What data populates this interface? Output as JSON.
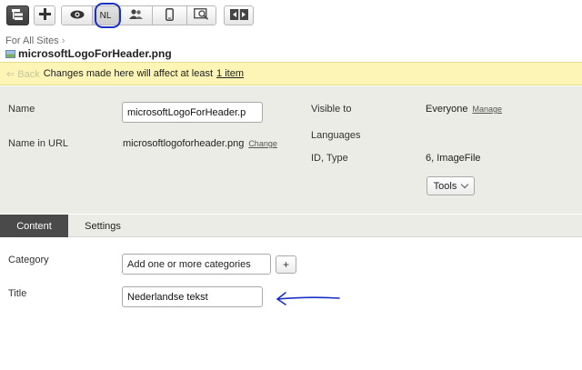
{
  "toolbar": {
    "buttons": [
      {
        "name": "tree-icon"
      },
      {
        "name": "add-icon",
        "glyph": "+"
      },
      {
        "name": "preview-eye-icon"
      },
      {
        "name": "language-button",
        "label": "NL"
      },
      {
        "name": "visitor-groups-icon"
      },
      {
        "name": "mobile-device-icon"
      },
      {
        "name": "zoom-preview-icon"
      },
      {
        "name": "compare-icon"
      }
    ],
    "highlight_color": "#1a2fc4"
  },
  "breadcrumb": {
    "label": "For All Sites",
    "separator": "›"
  },
  "page_title": "microsoftLogoForHeader.png",
  "notice": {
    "back_label": "⇐ Back",
    "text": "Changes made here will affect at least",
    "link": "1 item",
    "background": "#fcf5b5"
  },
  "properties": {
    "name_label": "Name",
    "name_value": "microsoftLogoForHeader.p",
    "url_label": "Name in URL",
    "url_value": "microsoftlogoforheader.png",
    "url_change": "Change",
    "visible_label": "Visible to",
    "visible_value": "Everyone",
    "visible_manage": "Manage",
    "languages_label": "Languages",
    "id_label": "ID, Type",
    "id_value": "6, ImageFile",
    "tools_label": "Tools"
  },
  "tabs": [
    {
      "label": "Content",
      "active": true
    },
    {
      "label": "Settings",
      "active": false
    }
  ],
  "content": {
    "category_label": "Category",
    "category_placeholder": "Add one or more categories",
    "category_add": "+",
    "title_label": "Title",
    "title_value": "Nederlandse tekst"
  },
  "annotation_arrow_color": "#1a2fc4"
}
